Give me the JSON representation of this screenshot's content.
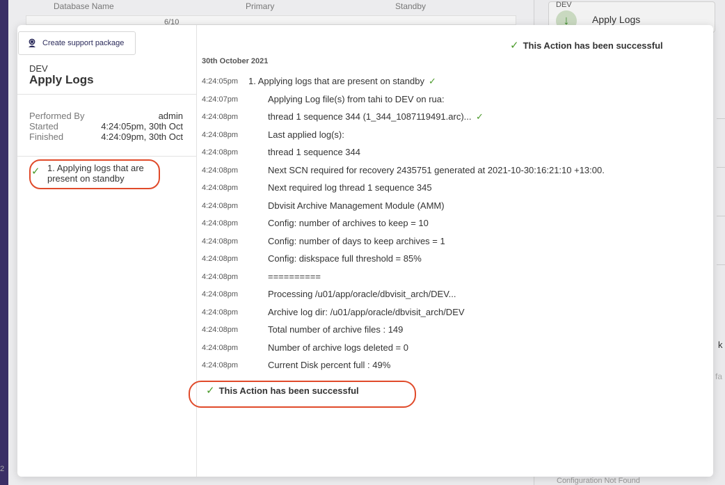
{
  "background": {
    "columns": [
      "Database Name",
      "Primary",
      "Standby"
    ],
    "row_count": "6/10",
    "card_db": "DEV",
    "card_action": "Apply Logs",
    "config_status": "Configuration Not Found",
    "page_num": "2",
    "cut_text_1": "k",
    "cut_text_2": "fa"
  },
  "modal": {
    "support_button": "Create support package",
    "sidebar": {
      "db_name": "DEV",
      "title": "Apply Logs",
      "performed_by_label": "Performed By",
      "performed_by": "admin",
      "started_label": "Started",
      "started": "4:24:05pm, 30th Oct",
      "finished_label": "Finished",
      "finished": "4:24:09pm, 30th Oct",
      "step_label": "1. Applying logs that are present on standby"
    },
    "success_message": "This Action has been successful",
    "log_date": "30th October 2021",
    "logs": [
      {
        "time": "4:24:05pm",
        "msg": "1. Applying logs that are present on standby",
        "step": true,
        "check": true
      },
      {
        "time": "4:24:07pm",
        "msg": "Applying Log file(s) from tahi to DEV on rua:"
      },
      {
        "time": "4:24:08pm",
        "msg": "thread 1 sequence 344 (1_344_1087119491.arc)...",
        "check": true
      },
      {
        "time": "4:24:08pm",
        "msg": "Last applied log(s):"
      },
      {
        "time": "4:24:08pm",
        "msg": "thread 1 sequence 344"
      },
      {
        "time": "4:24:08pm",
        "msg": "Next SCN required for recovery 2435751 generated at 2021-10-30:16:21:10 +13:00."
      },
      {
        "time": "4:24:08pm",
        "msg": "Next required log thread 1 sequence 345"
      },
      {
        "time": "4:24:08pm",
        "msg": "Dbvisit Archive Management Module (AMM)"
      },
      {
        "time": "4:24:08pm",
        "msg": "Config: number of archives to keep = 10"
      },
      {
        "time": "4:24:08pm",
        "msg": "Config: number of days to keep archives = 1"
      },
      {
        "time": "4:24:08pm",
        "msg": "Config: diskspace full threshold = 85%"
      },
      {
        "time": "4:24:08pm",
        "msg": "=========="
      },
      {
        "time": "4:24:08pm",
        "msg": "Processing /u01/app/oracle/dbvisit_arch/DEV..."
      },
      {
        "time": "4:24:08pm",
        "msg": "Archive log dir: /u01/app/oracle/dbvisit_arch/DEV"
      },
      {
        "time": "4:24:08pm",
        "msg": "Total number of archive files : 149"
      },
      {
        "time": "4:24:08pm",
        "msg": "Number of archive logs deleted = 0"
      },
      {
        "time": "4:24:08pm",
        "msg": "Current Disk percent full : 49%"
      }
    ],
    "colors": {
      "success": "#4a9a2a",
      "highlight": "#e04a2a"
    }
  }
}
